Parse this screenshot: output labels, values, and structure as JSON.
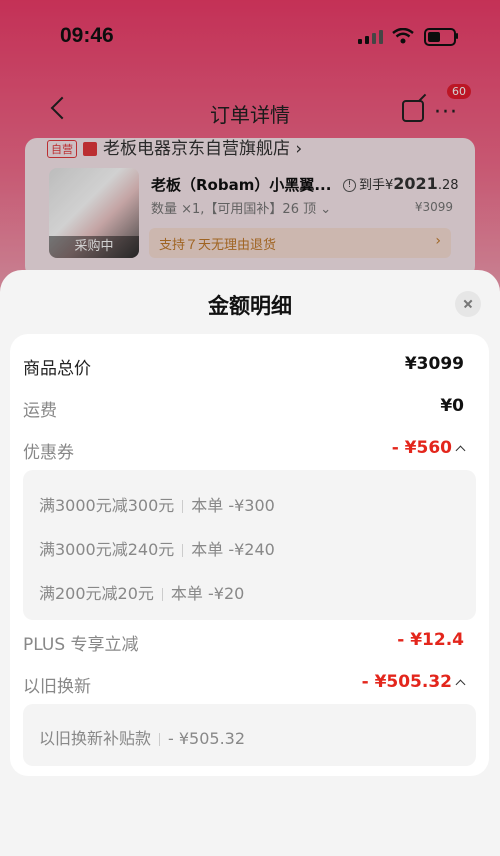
{
  "status_bar": {
    "time": "09:46"
  },
  "nav": {
    "title": "订单详情",
    "badge": "60"
  },
  "order": {
    "tag": "自营",
    "shop_name": "老板电器京东自营旗舰店 ›",
    "product_name": "老板（Robam）小黑翼...",
    "qty": "数量 ×1,【可用国补】26 顶 ⌄",
    "price_prefix": "到手¥",
    "price_int": "2021",
    "price_dec": ".28",
    "orig_price": "¥3099",
    "thumb_tag": "采购中",
    "return_text": "支持７天无理由退货",
    "return_chev": "›"
  },
  "sheet": {
    "title": "金额明细",
    "rows": {
      "total": {
        "label": "商品总价",
        "value": "¥3099"
      },
      "shipping": {
        "label": "运费",
        "value": "¥0"
      },
      "coupon": {
        "label": "优惠券",
        "value": "- ¥560"
      },
      "plus": {
        "label": "PLUS 专享立减",
        "value": "- ¥12.4"
      },
      "tradein": {
        "label": "以旧换新",
        "value": "- ¥505.32"
      }
    },
    "coupons": [
      {
        "name": "满3000元减300元",
        "amount": "本单 -¥300"
      },
      {
        "name": "满3000元减240元",
        "amount": "本单 -¥240"
      },
      {
        "name": "满200元减20元",
        "amount": "本单 -¥20"
      }
    ],
    "tradein_detail": {
      "name": "以旧换新补贴款",
      "amount": "- ¥505.32"
    }
  },
  "colors": {
    "discount_red": "#e3261c",
    "header_pink": "#f03c6a"
  }
}
